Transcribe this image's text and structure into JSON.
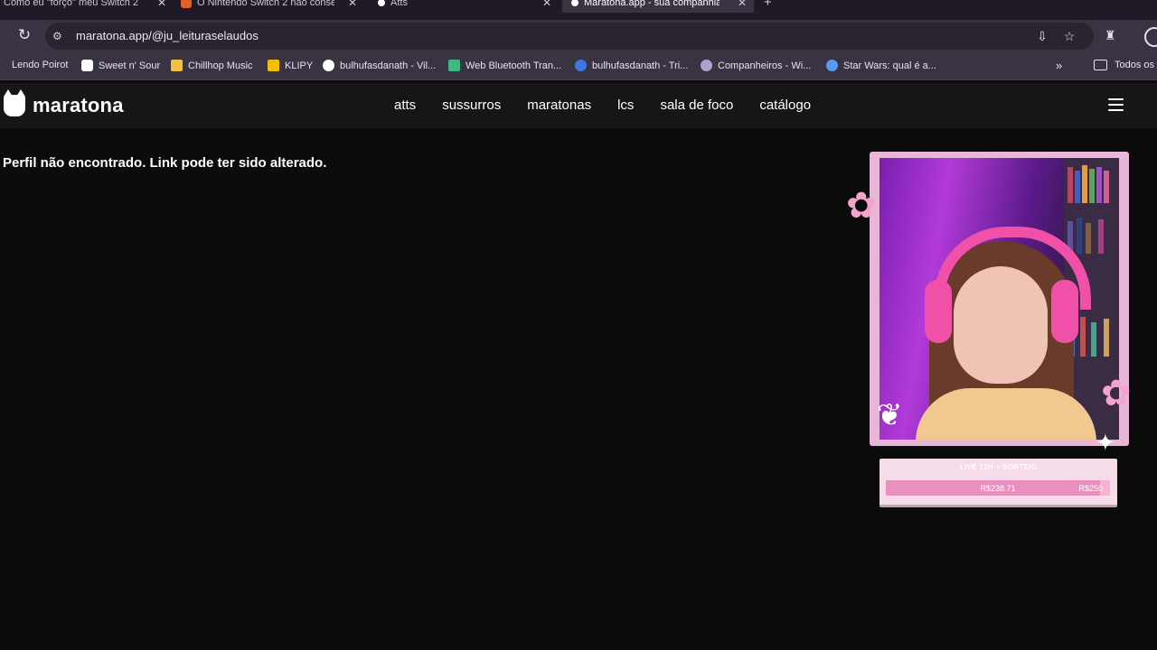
{
  "browser": {
    "tabs": [
      {
        "title": "Como eu \"forço\" meu Switch 2",
        "favicon_color": "#ff4444"
      },
      {
        "title": "O Nintendo Switch 2 não conse",
        "favicon_color": "#e0602a"
      },
      {
        "title": "Atts",
        "favicon_color": "#ffffff"
      },
      {
        "title": "Maratona.app - sua companhia",
        "favicon_color": "#ffffff",
        "active": true
      }
    ],
    "new_tab_icon": "+",
    "url": "maratona.app/@ju_leituraselaudos",
    "bookmarks": [
      {
        "label": "Lendo Poirot",
        "favicon_color": "#d04040"
      },
      {
        "label": "Sweet n' Sour",
        "favicon_color": "#ffffff"
      },
      {
        "label": "Chillhop Music",
        "favicon_color": "#f0c040"
      },
      {
        "label": "KLIPY",
        "favicon_color": "#f0c000"
      },
      {
        "label": "bulhufasdanath - Vil...",
        "favicon_color": "#ffffff"
      },
      {
        "label": "Web Bluetooth Tran...",
        "favicon_color": "#41b883"
      },
      {
        "label": "bulhufasdanath - Tri...",
        "favicon_color": "#3a7ae0"
      },
      {
        "label": "Companheiros - Wi...",
        "favicon_color": "#b0a0d0"
      },
      {
        "label": "Star Wars: qual é a...",
        "favicon_color": "#5a9af0"
      }
    ],
    "bookmarks_more": "»",
    "all_bookmarks": "Todos os f"
  },
  "site": {
    "logo_text": "maratona",
    "nav": [
      "atts",
      "sussurros",
      "maratonas",
      "lcs",
      "sala de foco",
      "catálogo"
    ],
    "error_message": "Perfil não encontrado. Link pode ter sido alterado."
  },
  "overlay": {
    "goal_title": "LIVE 12H + SORTEIO",
    "goal_current": "R$238.71",
    "goal_target": "R$250",
    "goal_progress": 0.955
  }
}
